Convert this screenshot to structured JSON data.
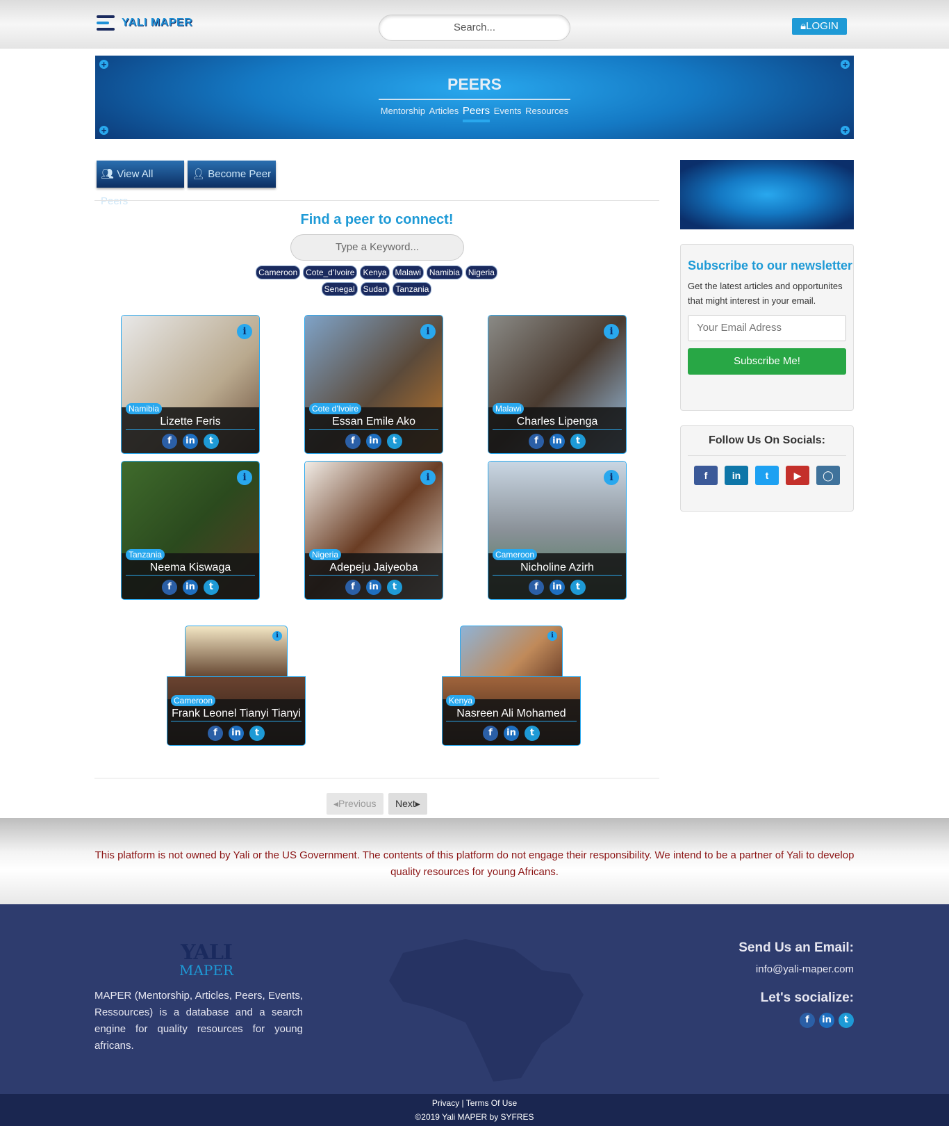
{
  "header": {
    "logo_text": "YALI MAPER",
    "search_placeholder": "Search...",
    "login_label": "LOGIN"
  },
  "banner": {
    "title": "PEERS",
    "nav": [
      "Mentorship",
      "Articles",
      "Peers",
      "Events",
      "Resources"
    ],
    "active": "Peers"
  },
  "actions": {
    "view_all": "View All Peers",
    "become": "Become Peer"
  },
  "finder": {
    "title": "Find a peer to connect!",
    "keyword_placeholder": "Type a Keyword...",
    "tags": [
      "Cameroon",
      "Cote_d'Ivoire",
      "Kenya",
      "Malawi",
      "Namibia",
      "Nigeria",
      "Senegal",
      "Sudan",
      "Tanzania"
    ]
  },
  "peers": [
    {
      "name": "Lizette Feris",
      "country": "Namibia"
    },
    {
      "name": "Essan Emile Ako",
      "country": "Cote d'Ivoire"
    },
    {
      "name": "Charles Lipenga",
      "country": "Malawi"
    },
    {
      "name": "Neema Kiswaga",
      "country": "Tanzania"
    },
    {
      "name": "Adepeju Jaiyeoba",
      "country": "Nigeria"
    },
    {
      "name": "Nicholine Azirh",
      "country": "Cameroon"
    },
    {
      "name": "Frank Leonel Tianyi Tianyi",
      "country": "Cameroon"
    },
    {
      "name": "Nasreen Ali Mohamed",
      "country": "Kenya"
    }
  ],
  "pagination": {
    "previous": "Previous",
    "next": "Next"
  },
  "newsletter": {
    "title": "Subscribe to our newsletter",
    "text": "Get the latest articles and opportunites that might interest in your email.",
    "email_placeholder": "Your Email Adress",
    "button": "Subscribe Me!"
  },
  "follow": {
    "title": "Follow Us On Socials:",
    "icons": [
      "facebook-icon",
      "linkedin-icon",
      "twitter-icon",
      "youtube-icon",
      "instagram-icon"
    ],
    "colors": [
      "#3b5998",
      "#0e76a8",
      "#1da1f2",
      "#c4302b",
      "#3f729b"
    ]
  },
  "disclaimer": "This platform is not owned by Yali or the US Government. The contents of this platform do not engage their responsibility. We intend to be a partner of Yali to develop quality resources for young Africans.",
  "footer": {
    "logo_top": "YALI",
    "logo_bottom": "MAPER",
    "about": "MAPER (Mentorship, Articles, Peers, Events, Ressources) is a database and a search engine for quality resources for young africans.",
    "email_title": "Send Us an Email:",
    "email": "info@yali-maper.com",
    "social_title": "Let's socialize:",
    "links": "Privacy | Terms Of Use",
    "copyright": "©2019 Yali MAPER by SYFRES"
  },
  "colors": {
    "accent": "#1e9ad6",
    "navy": "#1a2a5e",
    "footer": "#2e3c6e",
    "disclaimer": "#8b1414",
    "subscribe": "#28a745"
  }
}
